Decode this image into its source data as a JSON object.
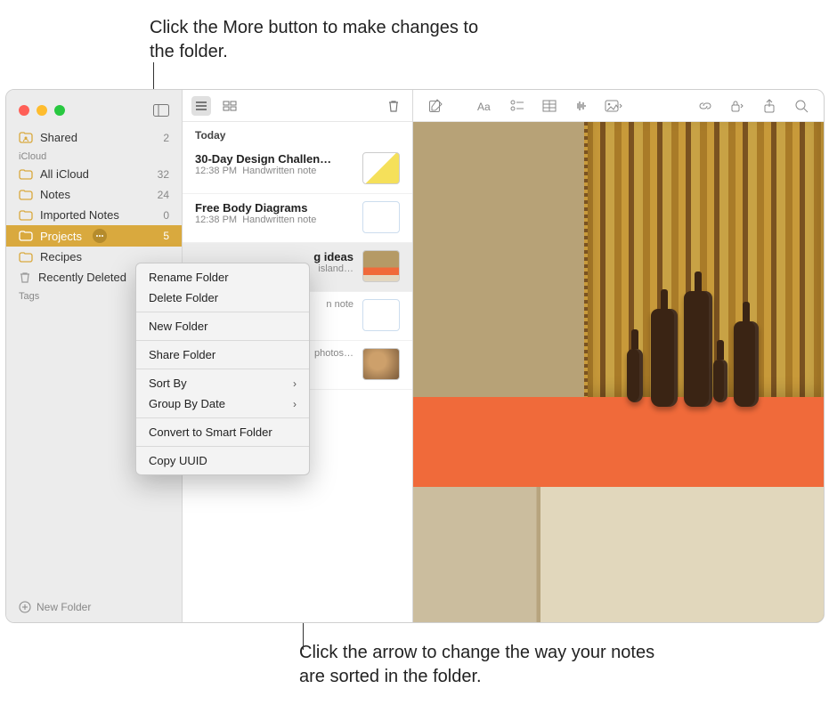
{
  "callouts": {
    "top": "Click the More button to make changes to the folder.",
    "bottom": "Click the arrow to change the way your notes are sorted in the folder."
  },
  "sidebar": {
    "shared": {
      "label": "Shared",
      "count": "2"
    },
    "section_icloud": "iCloud",
    "items": [
      {
        "label": "All iCloud",
        "count": "32"
      },
      {
        "label": "Notes",
        "count": "24"
      },
      {
        "label": "Imported Notes",
        "count": "0"
      },
      {
        "label": "Projects",
        "count": "5"
      },
      {
        "label": "Recipes",
        "count": ""
      },
      {
        "label": "Recently Deleted",
        "count": ""
      }
    ],
    "section_tags": "Tags",
    "new_folder": "New Folder"
  },
  "noteslist": {
    "group": "Today",
    "rows": [
      {
        "title": "30-Day Design Challen…",
        "time": "12:38 PM",
        "sub": "Handwritten note"
      },
      {
        "title": "Free Body Diagrams",
        "time": "12:38 PM",
        "sub": "Handwritten note"
      },
      {
        "title": "g ideas",
        "time": "",
        "sub": "island…"
      },
      {
        "title": "",
        "time": "",
        "sub": "n note"
      },
      {
        "title": "",
        "time": "",
        "sub": "photos…"
      }
    ]
  },
  "context_menu": {
    "items": [
      "Rename Folder",
      "Delete Folder",
      "New Folder",
      "Share Folder",
      "Sort By",
      "Group By Date",
      "Convert to Smart Folder",
      "Copy UUID"
    ]
  },
  "icons": {
    "sidebar_toggle": "sidebar-toggle-icon",
    "list_view": "list-view-icon",
    "grid_view": "grid-view-icon",
    "trash": "trash-icon",
    "compose": "compose-icon",
    "format": "format-icon",
    "checklist": "checklist-icon",
    "table": "table-icon",
    "sound": "waveform-icon",
    "media": "photo-icon",
    "link": "link-icon",
    "lock": "lock-icon",
    "share": "share-icon",
    "search": "search-icon",
    "more": "more-icon",
    "folder": "folder-icon",
    "shared": "shared-folder-icon",
    "deleted": "trash-folder-icon",
    "plus": "plus-circle-icon",
    "chevron": "chevron-right-icon",
    "chevron_down": "chevron-down-icon"
  }
}
